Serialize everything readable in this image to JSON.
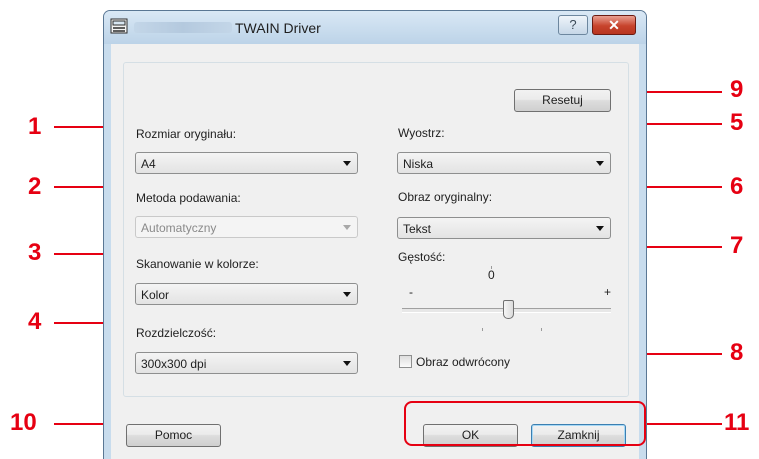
{
  "window": {
    "title": "TWAIN Driver",
    "help_glyph": "?",
    "close_glyph": "✕"
  },
  "fields": {
    "original_size": {
      "label": "Rozmiar oryginału:",
      "value": "A4"
    },
    "feed_method": {
      "label": "Metoda podawania:",
      "value": "Automatyczny",
      "enabled": false
    },
    "color_scan": {
      "label": "Skanowanie w kolorze:",
      "value": "Kolor"
    },
    "resolution": {
      "label": "Rozdzielczość:",
      "value": "300x300 dpi"
    },
    "sharpness": {
      "label": "Wyostrz:",
      "value": "Niska"
    },
    "original_image": {
      "label": "Obraz oryginalny:",
      "value": "Tekst"
    },
    "density": {
      "label": "Gęstość:",
      "center_value": "0",
      "minus": "-",
      "plus": "+",
      "level": 0
    },
    "inverted_image": {
      "label": "Obraz odwrócony",
      "checked": false
    }
  },
  "buttons": {
    "reset": "Resetuj",
    "help": "Pomoc",
    "ok": "OK",
    "close": "Zamknij"
  },
  "callouts": [
    "1",
    "2",
    "3",
    "4",
    "5",
    "6",
    "7",
    "8",
    "9",
    "10",
    "11"
  ],
  "colors": {
    "callout": "#e60012",
    "title_bar": "#c8dced",
    "dialog_bg": "#f0f0f0"
  }
}
